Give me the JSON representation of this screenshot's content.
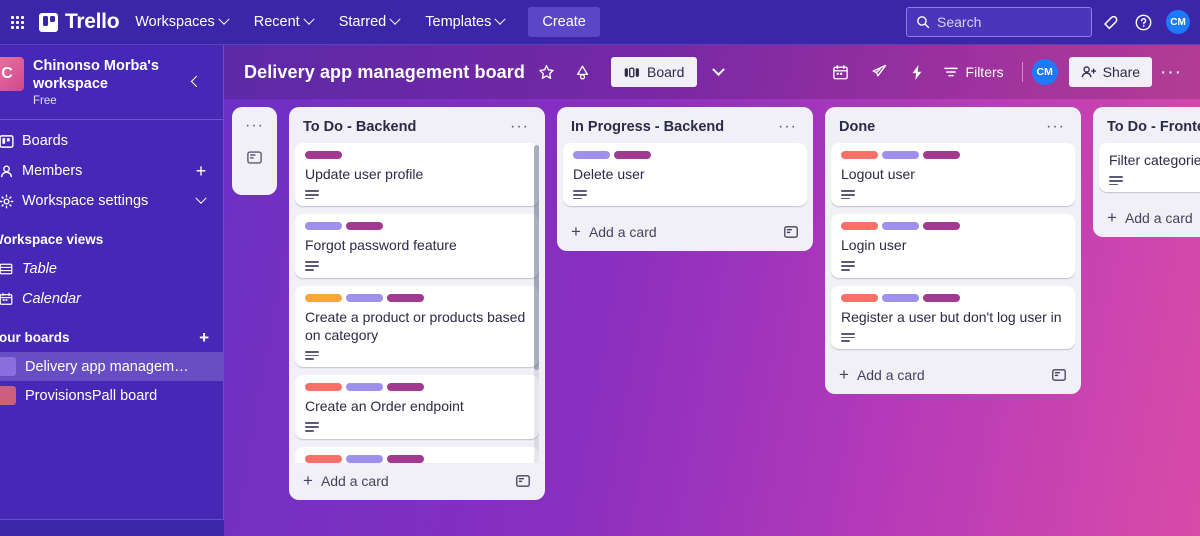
{
  "topnav": {
    "app_switcher": "app-switcher",
    "brand": "Trello",
    "items": [
      {
        "label": "Workspaces",
        "caret": true
      },
      {
        "label": "Recent",
        "caret": true
      },
      {
        "label": "Starred",
        "caret": true
      },
      {
        "label": "Templates",
        "caret": true
      }
    ],
    "create_label": "Create",
    "search": {
      "placeholder": "Search",
      "value": ""
    },
    "notifications_icon": "bell-icon",
    "help_icon": "help-circle-icon",
    "avatar_initials": "CM"
  },
  "sidebar": {
    "workspace": {
      "avatar_letter": "C",
      "name": "Chinonso Morba's workspace",
      "plan": "Free",
      "collapse_icon": "chevron-left-icon"
    },
    "nav": [
      {
        "label": "Boards",
        "icon": "board-icon",
        "right": ""
      },
      {
        "label": "Members",
        "icon": "members-icon",
        "right": "+"
      },
      {
        "label": "Workspace settings",
        "icon": "gear-icon",
        "right": "chevron-down-icon"
      }
    ],
    "views_heading": "Workspace views",
    "views": [
      {
        "label": "Table",
        "icon": "table-icon"
      },
      {
        "label": "Calendar",
        "icon": "calendar-icon"
      }
    ],
    "boards_heading": "Your boards",
    "boards_add": "+",
    "boards": [
      {
        "label": "Delivery app management b...",
        "color": "#8b6fdd",
        "active": true
      },
      {
        "label": "ProvisionsPall board",
        "color": "#cc5f7d",
        "active": false
      }
    ]
  },
  "board": {
    "title": "Delivery app management board",
    "star_icon": "star-icon",
    "visibility_icon": "workspace-visible-icon",
    "view_button": {
      "label": "Board",
      "icon": "board-view-icon"
    },
    "view_caret": "chevron-down-icon",
    "right_icons": [
      "calendar-icon",
      "rocket-icon",
      "automation-icon"
    ],
    "filters_label": "Filters",
    "member_initials": "CM",
    "share_label": "Share",
    "menu_dots": "···"
  },
  "collapsed_list": {
    "dots": "···",
    "template_icon": "card-template-icon"
  },
  "label_colors": {
    "orange": "#faa53d",
    "purple": "#9f8fef",
    "magenta": "#a23b8f",
    "red": "#f87168"
  },
  "add_card": {
    "label": "Add a card",
    "plus": "+",
    "template_icon": "card-template-icon"
  },
  "lists": [
    {
      "title": "To Do - Backend",
      "dots": "···",
      "has_scrollbar": true,
      "cards": [
        {
          "title": "Update user profile",
          "labels": [
            "magenta"
          ],
          "description": true
        },
        {
          "title": "Forgot password feature",
          "labels": [
            "purple",
            "magenta"
          ],
          "description": true
        },
        {
          "title": "Create a product or products based on category",
          "labels": [
            "orange",
            "purple",
            "magenta"
          ],
          "description": true
        },
        {
          "title": "Create an Order endpoint",
          "labels": [
            "red",
            "purple",
            "magenta"
          ],
          "description": true
        },
        {
          "title": "",
          "labels": [
            "red",
            "purple",
            "magenta"
          ],
          "description": false,
          "partial": true
        }
      ]
    },
    {
      "title": "In Progress - Backend",
      "dots": "···",
      "has_scrollbar": false,
      "cards": [
        {
          "title": "Delete user",
          "labels": [
            "purple",
            "magenta"
          ],
          "description": true
        }
      ]
    },
    {
      "title": "Done",
      "dots": "···",
      "has_scrollbar": false,
      "cards": [
        {
          "title": "Logout user",
          "labels": [
            "red",
            "purple",
            "magenta"
          ],
          "description": true
        },
        {
          "title": "Login user",
          "labels": [
            "red",
            "purple",
            "magenta"
          ],
          "description": true
        },
        {
          "title": "Register a user but don't log user in",
          "labels": [
            "red",
            "purple",
            "magenta"
          ],
          "description": true
        }
      ]
    },
    {
      "title": "To Do - Frontend",
      "dots": "",
      "has_scrollbar": false,
      "clipped": true,
      "cards": [
        {
          "title": "Filter categories",
          "labels": [],
          "description": true
        }
      ]
    }
  ]
}
